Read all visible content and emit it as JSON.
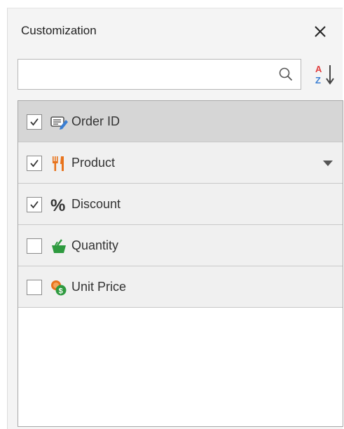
{
  "panel": {
    "title": "Customization",
    "close_icon": "close-icon",
    "search": {
      "value": "",
      "placeholder": "",
      "icon": "search-icon"
    },
    "sort_icon": "sort-az-icon"
  },
  "fields": [
    {
      "label": "Order ID",
      "checked": true,
      "icon": "id-card-icon",
      "selected": true,
      "has_dropdown": false
    },
    {
      "label": "Product",
      "checked": true,
      "icon": "fork-knife-icon",
      "selected": false,
      "has_dropdown": true
    },
    {
      "label": "Discount",
      "checked": true,
      "icon": "percent-icon",
      "selected": false,
      "has_dropdown": false
    },
    {
      "label": "Quantity",
      "checked": false,
      "icon": "basket-icon",
      "selected": false,
      "has_dropdown": false
    },
    {
      "label": "Unit Price",
      "checked": false,
      "icon": "coins-icon",
      "selected": false,
      "has_dropdown": false
    }
  ],
  "colors": {
    "panel_bg": "#f4f4f4",
    "row_bg": "#f0f0f0",
    "row_selected_bg": "#d6d6d6",
    "accent_orange": "#e8731c",
    "accent_green": "#2e9a3f",
    "accent_blue": "#3b7fd3"
  }
}
